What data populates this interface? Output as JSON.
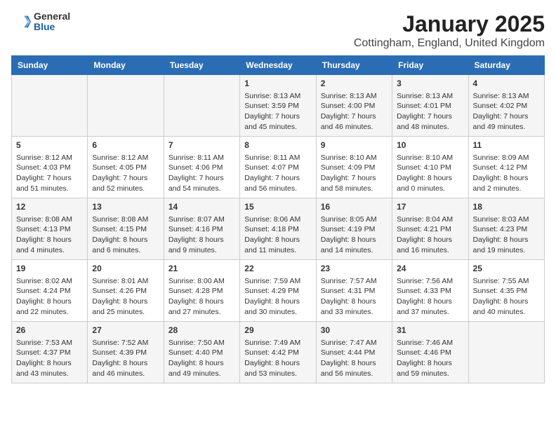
{
  "header": {
    "logo": {
      "line1": "General",
      "line2": "Blue"
    },
    "title": "January 2025",
    "subtitle": "Cottingham, England, United Kingdom"
  },
  "weekdays": [
    "Sunday",
    "Monday",
    "Tuesday",
    "Wednesday",
    "Thursday",
    "Friday",
    "Saturday"
  ],
  "weeks": [
    [
      {
        "day": "",
        "info": ""
      },
      {
        "day": "",
        "info": ""
      },
      {
        "day": "",
        "info": ""
      },
      {
        "day": "1",
        "info": "Sunrise: 8:13 AM\nSunset: 3:59 PM\nDaylight: 7 hours and 45 minutes."
      },
      {
        "day": "2",
        "info": "Sunrise: 8:13 AM\nSunset: 4:00 PM\nDaylight: 7 hours and 46 minutes."
      },
      {
        "day": "3",
        "info": "Sunrise: 8:13 AM\nSunset: 4:01 PM\nDaylight: 7 hours and 48 minutes."
      },
      {
        "day": "4",
        "info": "Sunrise: 8:13 AM\nSunset: 4:02 PM\nDaylight: 7 hours and 49 minutes."
      }
    ],
    [
      {
        "day": "5",
        "info": "Sunrise: 8:12 AM\nSunset: 4:03 PM\nDaylight: 7 hours and 51 minutes."
      },
      {
        "day": "6",
        "info": "Sunrise: 8:12 AM\nSunset: 4:05 PM\nDaylight: 7 hours and 52 minutes."
      },
      {
        "day": "7",
        "info": "Sunrise: 8:11 AM\nSunset: 4:06 PM\nDaylight: 7 hours and 54 minutes."
      },
      {
        "day": "8",
        "info": "Sunrise: 8:11 AM\nSunset: 4:07 PM\nDaylight: 7 hours and 56 minutes."
      },
      {
        "day": "9",
        "info": "Sunrise: 8:10 AM\nSunset: 4:09 PM\nDaylight: 7 hours and 58 minutes."
      },
      {
        "day": "10",
        "info": "Sunrise: 8:10 AM\nSunset: 4:10 PM\nDaylight: 8 hours and 0 minutes."
      },
      {
        "day": "11",
        "info": "Sunrise: 8:09 AM\nSunset: 4:12 PM\nDaylight: 8 hours and 2 minutes."
      }
    ],
    [
      {
        "day": "12",
        "info": "Sunrise: 8:08 AM\nSunset: 4:13 PM\nDaylight: 8 hours and 4 minutes."
      },
      {
        "day": "13",
        "info": "Sunrise: 8:08 AM\nSunset: 4:15 PM\nDaylight: 8 hours and 6 minutes."
      },
      {
        "day": "14",
        "info": "Sunrise: 8:07 AM\nSunset: 4:16 PM\nDaylight: 8 hours and 9 minutes."
      },
      {
        "day": "15",
        "info": "Sunrise: 8:06 AM\nSunset: 4:18 PM\nDaylight: 8 hours and 11 minutes."
      },
      {
        "day": "16",
        "info": "Sunrise: 8:05 AM\nSunset: 4:19 PM\nDaylight: 8 hours and 14 minutes."
      },
      {
        "day": "17",
        "info": "Sunrise: 8:04 AM\nSunset: 4:21 PM\nDaylight: 8 hours and 16 minutes."
      },
      {
        "day": "18",
        "info": "Sunrise: 8:03 AM\nSunset: 4:23 PM\nDaylight: 8 hours and 19 minutes."
      }
    ],
    [
      {
        "day": "19",
        "info": "Sunrise: 8:02 AM\nSunset: 4:24 PM\nDaylight: 8 hours and 22 minutes."
      },
      {
        "day": "20",
        "info": "Sunrise: 8:01 AM\nSunset: 4:26 PM\nDaylight: 8 hours and 25 minutes."
      },
      {
        "day": "21",
        "info": "Sunrise: 8:00 AM\nSunset: 4:28 PM\nDaylight: 8 hours and 27 minutes."
      },
      {
        "day": "22",
        "info": "Sunrise: 7:59 AM\nSunset: 4:29 PM\nDaylight: 8 hours and 30 minutes."
      },
      {
        "day": "23",
        "info": "Sunrise: 7:57 AM\nSunset: 4:31 PM\nDaylight: 8 hours and 33 minutes."
      },
      {
        "day": "24",
        "info": "Sunrise: 7:56 AM\nSunset: 4:33 PM\nDaylight: 8 hours and 37 minutes."
      },
      {
        "day": "25",
        "info": "Sunrise: 7:55 AM\nSunset: 4:35 PM\nDaylight: 8 hours and 40 minutes."
      }
    ],
    [
      {
        "day": "26",
        "info": "Sunrise: 7:53 AM\nSunset: 4:37 PM\nDaylight: 8 hours and 43 minutes."
      },
      {
        "day": "27",
        "info": "Sunrise: 7:52 AM\nSunset: 4:39 PM\nDaylight: 8 hours and 46 minutes."
      },
      {
        "day": "28",
        "info": "Sunrise: 7:50 AM\nSunset: 4:40 PM\nDaylight: 8 hours and 49 minutes."
      },
      {
        "day": "29",
        "info": "Sunrise: 7:49 AM\nSunset: 4:42 PM\nDaylight: 8 hours and 53 minutes."
      },
      {
        "day": "30",
        "info": "Sunrise: 7:47 AM\nSunset: 4:44 PM\nDaylight: 8 hours and 56 minutes."
      },
      {
        "day": "31",
        "info": "Sunrise: 7:46 AM\nSunset: 4:46 PM\nDaylight: 8 hours and 59 minutes."
      },
      {
        "day": "",
        "info": ""
      }
    ]
  ]
}
